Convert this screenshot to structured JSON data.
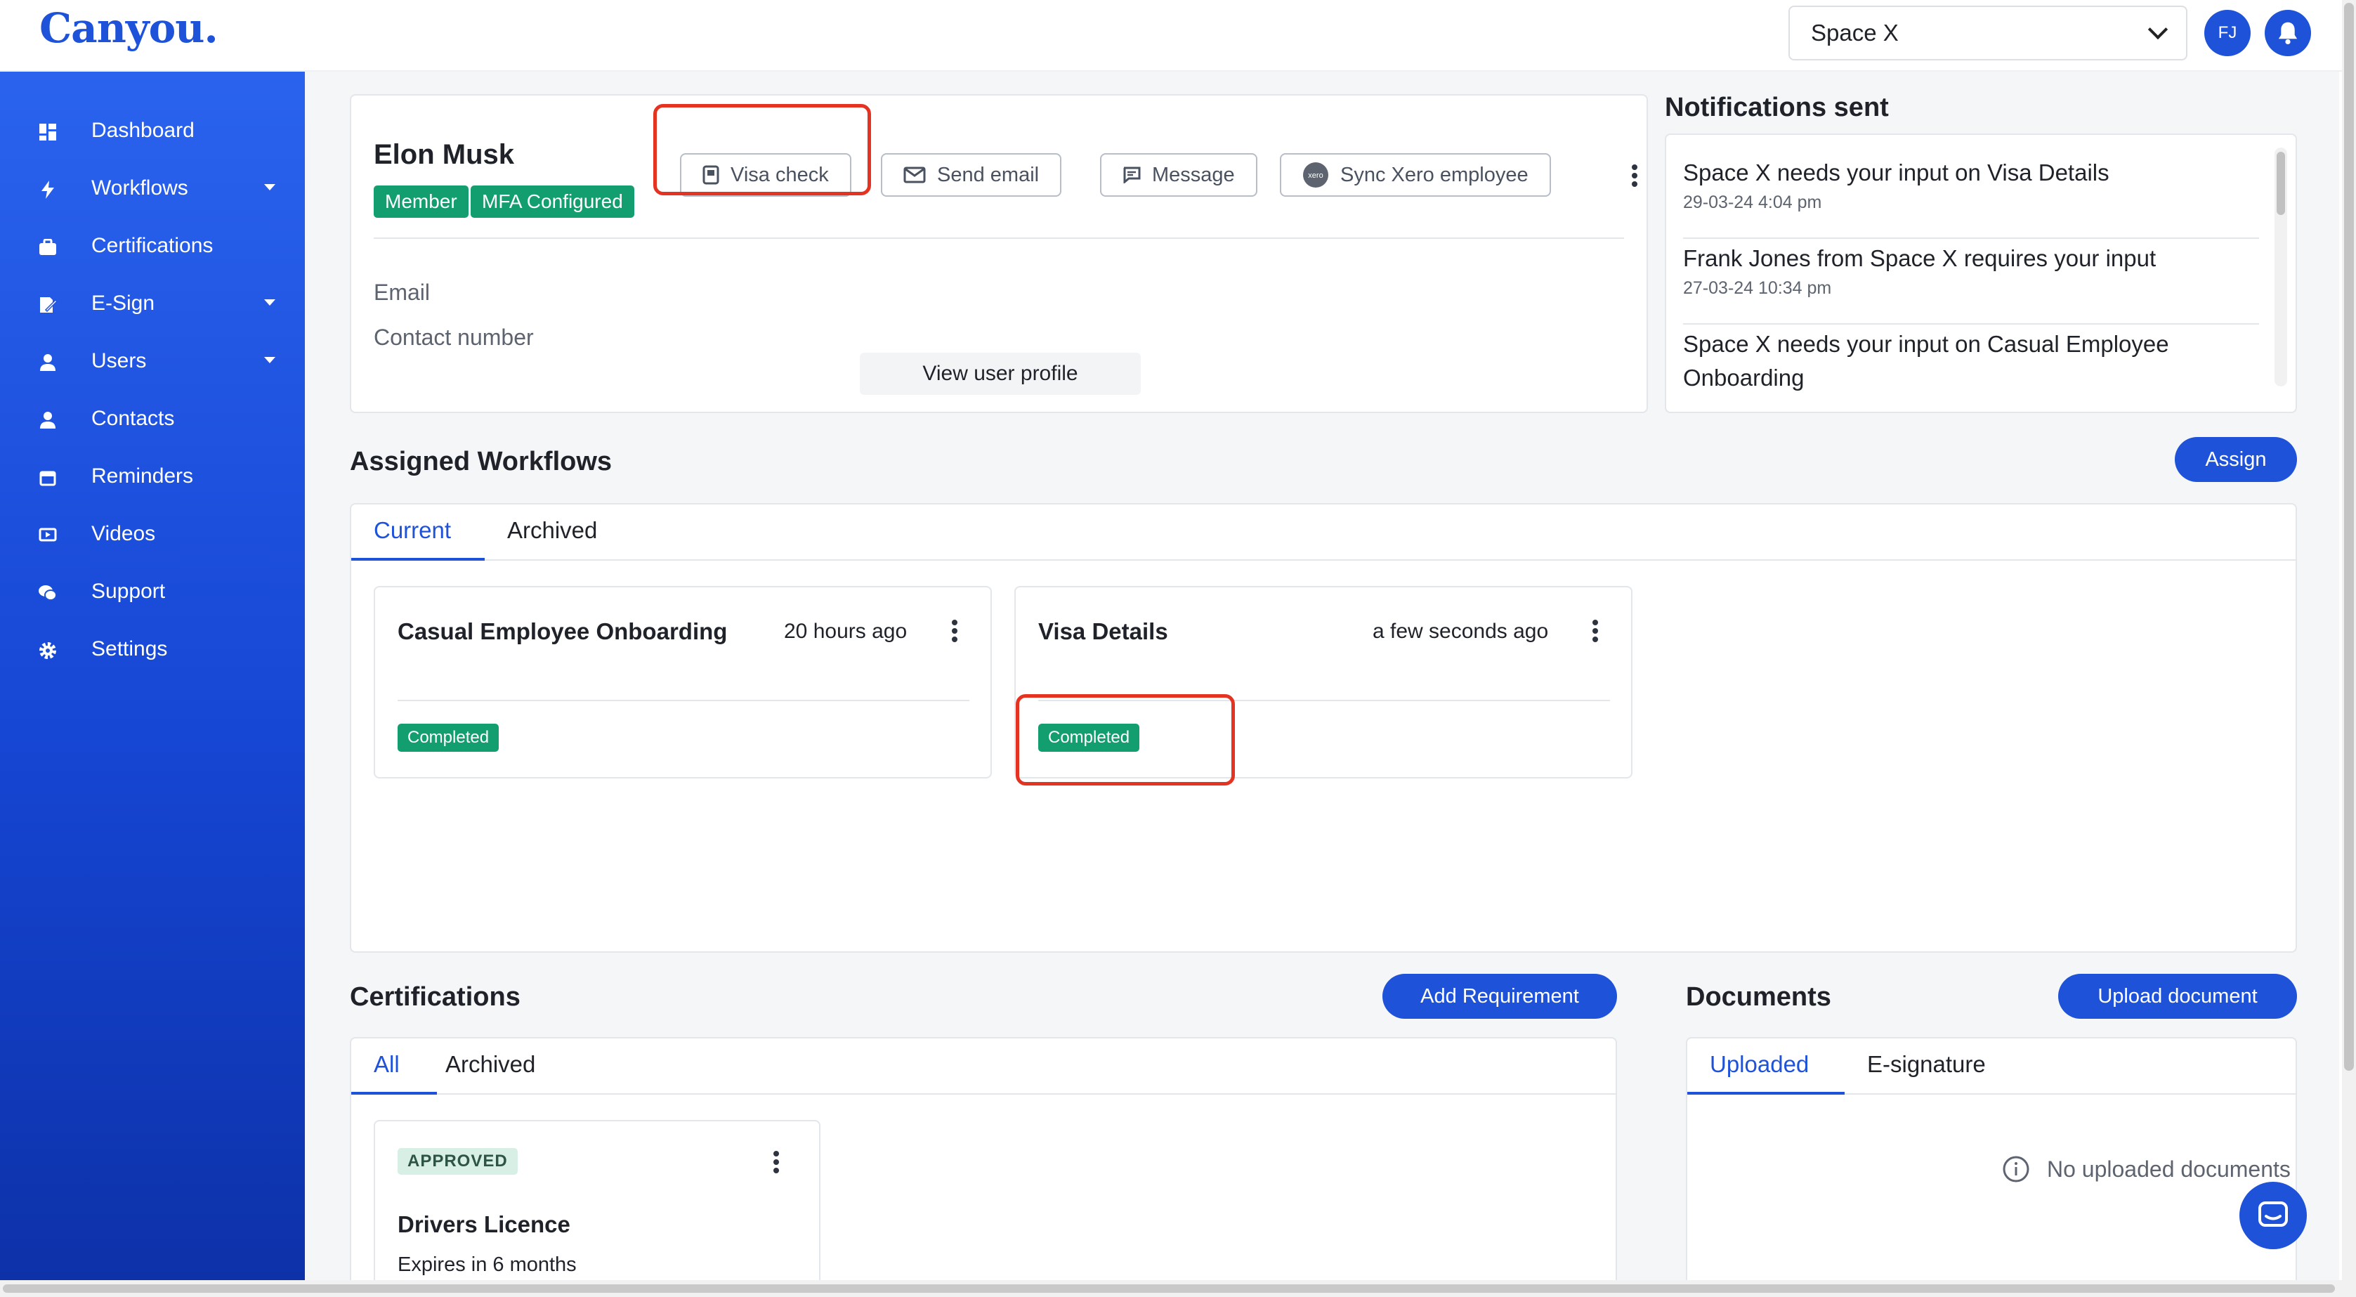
{
  "header": {
    "logo": "Canyou.",
    "space_select": "Space X",
    "avatar_initials": "FJ"
  },
  "sidebar": {
    "items": [
      {
        "label": "Dashboard",
        "icon": "dashboard-icon",
        "expandable": false
      },
      {
        "label": "Workflows",
        "icon": "lightning-icon",
        "expandable": true
      },
      {
        "label": "Certifications",
        "icon": "briefcase-icon",
        "expandable": false
      },
      {
        "label": "E-Sign",
        "icon": "signature-icon",
        "expandable": true
      },
      {
        "label": "Users",
        "icon": "user-icon",
        "expandable": true
      },
      {
        "label": "Contacts",
        "icon": "contact-icon",
        "expandable": false
      },
      {
        "label": "Reminders",
        "icon": "calendar-icon",
        "expandable": false
      },
      {
        "label": "Videos",
        "icon": "video-icon",
        "expandable": false
      },
      {
        "label": "Support",
        "icon": "support-icon",
        "expandable": false
      },
      {
        "label": "Settings",
        "icon": "gear-icon",
        "expandable": false
      }
    ]
  },
  "user_card": {
    "name": "Elon Musk",
    "badges": [
      "Member",
      "MFA Configured"
    ],
    "actions": {
      "visa_check": "Visa check",
      "send_email": "Send email",
      "message": "Message",
      "sync_xero": "Sync Xero employee",
      "xero_logo_text": "xero"
    },
    "email_label": "Email",
    "contact_label": "Contact number",
    "view_profile": "View user profile"
  },
  "notifications": {
    "title": "Notifications sent",
    "items": [
      {
        "text": "Space X needs your input on Visa Details",
        "time": "29-03-24 4:04 pm"
      },
      {
        "text": "Frank Jones from Space X requires your input",
        "time": "27-03-24 10:34 pm"
      },
      {
        "text": "Space X needs your input on Casual Employee Onboarding",
        "time": ""
      }
    ]
  },
  "workflows": {
    "title": "Assigned Workflows",
    "assign_button": "Assign",
    "tabs": [
      {
        "label": "Current",
        "active": true
      },
      {
        "label": "Archived",
        "active": false
      }
    ],
    "cards": [
      {
        "title": "Casual Employee Onboarding",
        "time": "20 hours ago",
        "status": "Completed"
      },
      {
        "title": "Visa Details",
        "time": "a few seconds ago",
        "status": "Completed"
      }
    ]
  },
  "certifications": {
    "title": "Certifications",
    "add_button": "Add Requirement",
    "tabs": [
      {
        "label": "All",
        "active": true
      },
      {
        "label": "Archived",
        "active": false
      }
    ],
    "cards": [
      {
        "status": "APPROVED",
        "title": "Drivers Licence",
        "expires": "Expires in 6 months"
      }
    ]
  },
  "documents": {
    "title": "Documents",
    "upload_button": "Upload document",
    "tabs": [
      {
        "label": "Uploaded",
        "active": true
      },
      {
        "label": "E-signature",
        "active": false
      }
    ],
    "empty_message": "No uploaded documents"
  },
  "colors": {
    "brand": "#1e52d9",
    "success": "#129e6e",
    "highlight": "#e53322"
  }
}
